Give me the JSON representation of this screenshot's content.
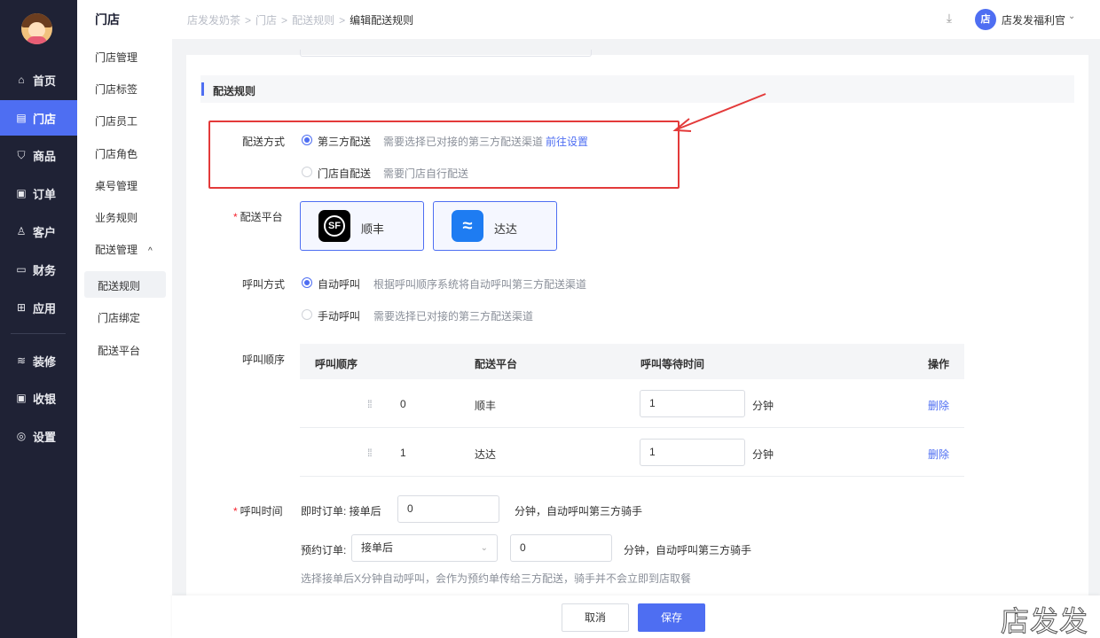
{
  "sidebar": {
    "items": [
      {
        "icon": "home-icon",
        "glyph": "⌂",
        "label": "首页"
      },
      {
        "icon": "store-icon",
        "glyph": "▤",
        "label": "门店"
      },
      {
        "icon": "bag-icon",
        "glyph": "⛉",
        "label": "商品"
      },
      {
        "icon": "order-icon",
        "glyph": "▣",
        "label": "订单"
      },
      {
        "icon": "user-icon",
        "glyph": "♙",
        "label": "客户"
      },
      {
        "icon": "wallet-icon",
        "glyph": "▭",
        "label": "财务"
      },
      {
        "icon": "apps-icon",
        "glyph": "⊞",
        "label": "应用"
      },
      {
        "icon": "layers-icon",
        "glyph": "≋",
        "label": "装修"
      },
      {
        "icon": "cashier-icon",
        "glyph": "▣",
        "label": "收银"
      },
      {
        "icon": "settings-icon",
        "glyph": "◎",
        "label": "设置"
      }
    ],
    "active": "门店"
  },
  "submenu": {
    "title": "门店",
    "items": [
      "门店管理",
      "门店标签",
      "门店员工",
      "门店角色",
      "桌号管理",
      "业务规则",
      "配送管理"
    ],
    "group_chevron": "^",
    "sub_items": [
      "配送规则",
      "门店绑定",
      "配送平台"
    ],
    "active": "配送规则"
  },
  "topbar": {
    "breadcrumb": [
      "店发发奶茶",
      "门店",
      "配送规则",
      "编辑配送规则"
    ],
    "sep": ">",
    "download_icon": "download-icon",
    "download_glyph": "⤓",
    "user_avatar": "店",
    "user_name": "店发发福利官",
    "user_chevron": "⌄"
  },
  "section": {
    "title": "配送规则"
  },
  "delivery_method": {
    "label": "配送方式",
    "options": [
      {
        "label": "第三方配送",
        "hint": "需要选择已对接的第三方配送渠道",
        "link": "前往设置",
        "selected": true
      },
      {
        "label": "门店自配送",
        "hint": "需要门店自行配送",
        "selected": false
      }
    ]
  },
  "platform": {
    "label": "配送平台",
    "required": "*",
    "items": [
      {
        "name": "顺丰",
        "logo_text": "SF",
        "color": "#000000"
      },
      {
        "name": "达达",
        "logo_text": "≈",
        "color": "#1e7cf2"
      }
    ]
  },
  "call_method": {
    "label": "呼叫方式",
    "options": [
      {
        "label": "自动呼叫",
        "hint": "根据呼叫顺序系统将自动呼叫第三方配送渠道",
        "selected": true
      },
      {
        "label": "手动呼叫",
        "hint": "需要选择已对接的第三方配送渠道",
        "selected": false
      }
    ]
  },
  "call_order": {
    "label": "呼叫顺序",
    "columns": [
      "呼叫顺序",
      "配送平台",
      "呼叫等待时间",
      "操作"
    ],
    "drag_glyph": "⁞⁞",
    "unit": "分钟",
    "delete_label": "删除",
    "rows": [
      {
        "order": "0",
        "platform": "顺丰",
        "wait": "1"
      },
      {
        "order": "1",
        "platform": "达达",
        "wait": "1"
      }
    ]
  },
  "call_time": {
    "label": "呼叫时间",
    "required": "*",
    "instant_prefix": "即时订单:  接单后",
    "instant_value": "0",
    "instant_suffix": "分钟，自动呼叫第三方骑手",
    "reserve_prefix": "预约订单:",
    "reserve_select": "接单后",
    "reserve_value": "0",
    "reserve_suffix": "分钟，自动呼叫第三方骑手",
    "note": "选择接单后X分钟自动呼叫，会作为预约单传给三方配送，骑手并不会立即到店取餐"
  },
  "footer": {
    "cancel": "取消",
    "save": "保存"
  },
  "watermark": "店发发",
  "colors": {
    "accent": "#4e6ef2",
    "sidebar_bg": "#1f2235",
    "annotation_red": "#e33a3a"
  }
}
